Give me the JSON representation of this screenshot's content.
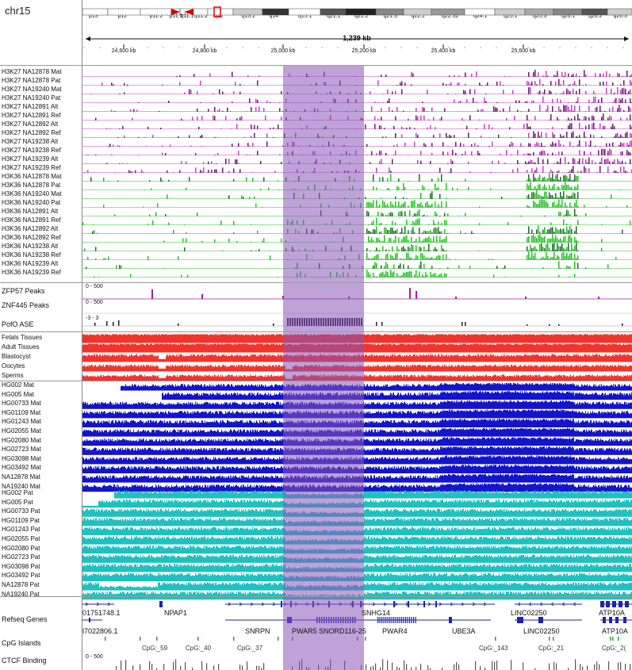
{
  "chromosome": "chr15",
  "ideogram_bands": [
    "p13",
    "p12",
    "p11.2",
    "p11.1",
    "q11.1",
    "q11.2",
    "q12",
    "q13.2",
    "q14",
    "q15.1",
    "q21.1",
    "q21.2",
    "q21.3",
    "q22.2",
    "q22.32",
    "q24.1",
    "q25.1",
    "q25.3",
    "q26.1",
    "q26.2",
    "q26.3"
  ],
  "ruler": {
    "span": "1,239 kb",
    "ticks": [
      "24,600 kb",
      "24,800 kb",
      "25,000 kb",
      "25,200 kb",
      "25,400 kb",
      "25,600 kb"
    ]
  },
  "tracks": {
    "h3k27": [
      "H3K27 NA12878 Mat",
      "H3K27 NA12878 Pat",
      "H3K27 NA19240 Mat",
      "H3K27 NA19240 Pat",
      "H3K27 NA12891 Alt",
      "H3K27 NA12891 Ref",
      "H3K27 NA12892 Alt",
      "H3K27 NA12892 Ref",
      "H3K27 NA19238 Alt",
      "H3K27 NA19238 Ref",
      "H3K27 NA19239 Alt",
      "H3K27 NA19239 Ref"
    ],
    "h3k36": [
      "H3K36 NA12878 Mat",
      "H3K36 NA12878 Pat",
      "H3K36 NA19240 Mat",
      "H3K36 NA19240 Pat",
      "H3K36 NA12891 Alt",
      "H3K36 NA12891 Ref",
      "H3K36 NA12892 Alt",
      "H3K36 NA12892 Ref",
      "H3K36 NA19238 Alt",
      "H3K36 NA19238 Ref",
      "H3K36 NA19239 Alt",
      "H3K36 NA19239 Ref"
    ],
    "zfp57": {
      "label": "ZFP57 Peaks",
      "range": "0 - 500"
    },
    "znf445": {
      "label": "ZNF445 Peaks",
      "range": "0 - 500"
    },
    "pofo": {
      "label": "PofO ASE",
      "range": "-3 - 3"
    },
    "tissues": [
      "Fetals Tissues",
      "Adult Tissues",
      "Blastocyst",
      "Oocytes",
      "Sperms"
    ],
    "mat": [
      "HG002 Mat",
      "HG005 Mat",
      "HG00733 Mat",
      "HG01109 Mat",
      "HG01243 Mat",
      "HG02055 Mat",
      "HG02080 Mat",
      "HG02723 Mat",
      "HG03098 Mat",
      "HG03492 Mat",
      "NA12878 Mat",
      "NA19240 Mat"
    ],
    "pat": [
      "HG002 Pat",
      "HG005 Pat",
      "HG00733 Pat",
      "HG01109 Pat",
      "HG01243 Pat",
      "HG02055 Pat",
      "HG02080 Pat",
      "HG02723 Pat",
      "HG03098 Pat",
      "HG03492 Pat",
      "NA12878 Pat",
      "NA19240 Pat"
    ],
    "refseq": {
      "label": "Refseq Genes"
    },
    "cpg": {
      "label": "CpG Islands"
    },
    "ctcf": {
      "label": "CTCF Binding",
      "range": "0 - 500"
    }
  },
  "genes": {
    "row1": [
      "01751748.1",
      "NPAP1",
      "SNHG14",
      "LINC02250",
      "ATP10A"
    ],
    "row2": [
      "l7022806.1",
      "SNRPN",
      "PWAR5",
      "SNORD116-25",
      "PWAR4",
      "UBE3A",
      "LINC02250",
      "ATP10A"
    ]
  },
  "cpg_islands": [
    "CpG:_59",
    "CpG:_40",
    "CpG:_37",
    "CpG:_143",
    "CpG:_21",
    "CpG:_2("
  ],
  "colors": {
    "h3k27_dark": "#6a1b6e",
    "h3k27_light": "#c83fc8",
    "h3k36_dark": "#1e6b2a",
    "h3k36_light": "#2eb82e",
    "h3k36_bright": "#1fcf1f",
    "zfp57": "#a020a0",
    "pofo": "#2a1a3a",
    "tissue": "#f0342c",
    "mat": "#1414c8",
    "pat": "#1fc0c0",
    "highlight": "#8856b8",
    "ctcf": "#555555"
  }
}
